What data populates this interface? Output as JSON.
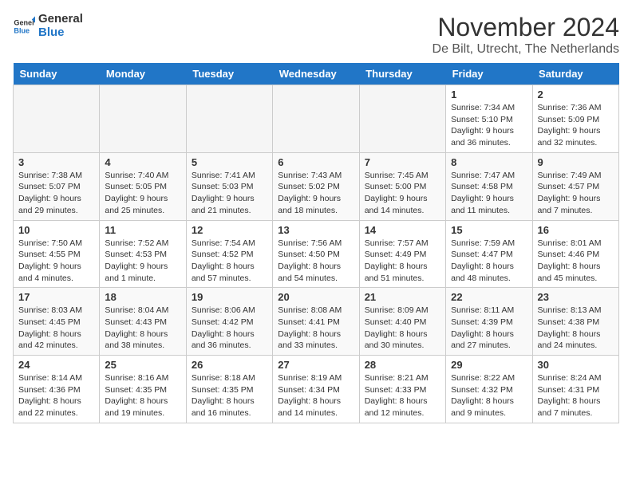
{
  "header": {
    "logo_general": "General",
    "logo_blue": "Blue",
    "month_title": "November 2024",
    "location": "De Bilt, Utrecht, The Netherlands"
  },
  "weekdays": [
    "Sunday",
    "Monday",
    "Tuesday",
    "Wednesday",
    "Thursday",
    "Friday",
    "Saturday"
  ],
  "weeks": [
    [
      {
        "day": "",
        "info": ""
      },
      {
        "day": "",
        "info": ""
      },
      {
        "day": "",
        "info": ""
      },
      {
        "day": "",
        "info": ""
      },
      {
        "day": "",
        "info": ""
      },
      {
        "day": "1",
        "info": "Sunrise: 7:34 AM\nSunset: 5:10 PM\nDaylight: 9 hours and 36 minutes."
      },
      {
        "day": "2",
        "info": "Sunrise: 7:36 AM\nSunset: 5:09 PM\nDaylight: 9 hours and 32 minutes."
      }
    ],
    [
      {
        "day": "3",
        "info": "Sunrise: 7:38 AM\nSunset: 5:07 PM\nDaylight: 9 hours and 29 minutes."
      },
      {
        "day": "4",
        "info": "Sunrise: 7:40 AM\nSunset: 5:05 PM\nDaylight: 9 hours and 25 minutes."
      },
      {
        "day": "5",
        "info": "Sunrise: 7:41 AM\nSunset: 5:03 PM\nDaylight: 9 hours and 21 minutes."
      },
      {
        "day": "6",
        "info": "Sunrise: 7:43 AM\nSunset: 5:02 PM\nDaylight: 9 hours and 18 minutes."
      },
      {
        "day": "7",
        "info": "Sunrise: 7:45 AM\nSunset: 5:00 PM\nDaylight: 9 hours and 14 minutes."
      },
      {
        "day": "8",
        "info": "Sunrise: 7:47 AM\nSunset: 4:58 PM\nDaylight: 9 hours and 11 minutes."
      },
      {
        "day": "9",
        "info": "Sunrise: 7:49 AM\nSunset: 4:57 PM\nDaylight: 9 hours and 7 minutes."
      }
    ],
    [
      {
        "day": "10",
        "info": "Sunrise: 7:50 AM\nSunset: 4:55 PM\nDaylight: 9 hours and 4 minutes."
      },
      {
        "day": "11",
        "info": "Sunrise: 7:52 AM\nSunset: 4:53 PM\nDaylight: 9 hours and 1 minute."
      },
      {
        "day": "12",
        "info": "Sunrise: 7:54 AM\nSunset: 4:52 PM\nDaylight: 8 hours and 57 minutes."
      },
      {
        "day": "13",
        "info": "Sunrise: 7:56 AM\nSunset: 4:50 PM\nDaylight: 8 hours and 54 minutes."
      },
      {
        "day": "14",
        "info": "Sunrise: 7:57 AM\nSunset: 4:49 PM\nDaylight: 8 hours and 51 minutes."
      },
      {
        "day": "15",
        "info": "Sunrise: 7:59 AM\nSunset: 4:47 PM\nDaylight: 8 hours and 48 minutes."
      },
      {
        "day": "16",
        "info": "Sunrise: 8:01 AM\nSunset: 4:46 PM\nDaylight: 8 hours and 45 minutes."
      }
    ],
    [
      {
        "day": "17",
        "info": "Sunrise: 8:03 AM\nSunset: 4:45 PM\nDaylight: 8 hours and 42 minutes."
      },
      {
        "day": "18",
        "info": "Sunrise: 8:04 AM\nSunset: 4:43 PM\nDaylight: 8 hours and 38 minutes."
      },
      {
        "day": "19",
        "info": "Sunrise: 8:06 AM\nSunset: 4:42 PM\nDaylight: 8 hours and 36 minutes."
      },
      {
        "day": "20",
        "info": "Sunrise: 8:08 AM\nSunset: 4:41 PM\nDaylight: 8 hours and 33 minutes."
      },
      {
        "day": "21",
        "info": "Sunrise: 8:09 AM\nSunset: 4:40 PM\nDaylight: 8 hours and 30 minutes."
      },
      {
        "day": "22",
        "info": "Sunrise: 8:11 AM\nSunset: 4:39 PM\nDaylight: 8 hours and 27 minutes."
      },
      {
        "day": "23",
        "info": "Sunrise: 8:13 AM\nSunset: 4:38 PM\nDaylight: 8 hours and 24 minutes."
      }
    ],
    [
      {
        "day": "24",
        "info": "Sunrise: 8:14 AM\nSunset: 4:36 PM\nDaylight: 8 hours and 22 minutes."
      },
      {
        "day": "25",
        "info": "Sunrise: 8:16 AM\nSunset: 4:35 PM\nDaylight: 8 hours and 19 minutes."
      },
      {
        "day": "26",
        "info": "Sunrise: 8:18 AM\nSunset: 4:35 PM\nDaylight: 8 hours and 16 minutes."
      },
      {
        "day": "27",
        "info": "Sunrise: 8:19 AM\nSunset: 4:34 PM\nDaylight: 8 hours and 14 minutes."
      },
      {
        "day": "28",
        "info": "Sunrise: 8:21 AM\nSunset: 4:33 PM\nDaylight: 8 hours and 12 minutes."
      },
      {
        "day": "29",
        "info": "Sunrise: 8:22 AM\nSunset: 4:32 PM\nDaylight: 8 hours and 9 minutes."
      },
      {
        "day": "30",
        "info": "Sunrise: 8:24 AM\nSunset: 4:31 PM\nDaylight: 8 hours and 7 minutes."
      }
    ]
  ]
}
